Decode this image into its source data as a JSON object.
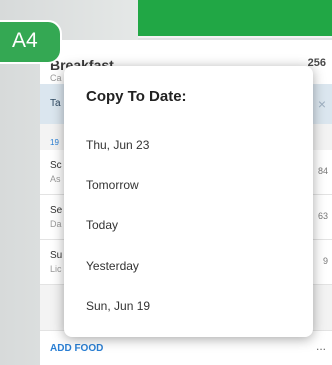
{
  "badge": {
    "label": "A4"
  },
  "meal": {
    "title": "Breakfast",
    "subtitle": "Ca",
    "calories": "256"
  },
  "tab": {
    "label": "Ta",
    "close_icon": "close-icon"
  },
  "time_label": "19",
  "food_items": [
    {
      "name": "Sc",
      "desc": "As",
      "cal": "84"
    },
    {
      "name": "Se",
      "desc": "Da",
      "cal": "63"
    },
    {
      "name": "Su",
      "desc": "Lic",
      "cal": "9"
    }
  ],
  "footer": {
    "add_food": "ADD FOOD",
    "more": "..."
  },
  "modal": {
    "title": "Copy To Date:",
    "options": [
      "Thu, Jun 23",
      "Tomorrow",
      "Today",
      "Yesterday",
      "Sun, Jun 19"
    ]
  },
  "colors": {
    "green": "#21a745",
    "badge": "#34a853",
    "link": "#2a7fd4"
  }
}
